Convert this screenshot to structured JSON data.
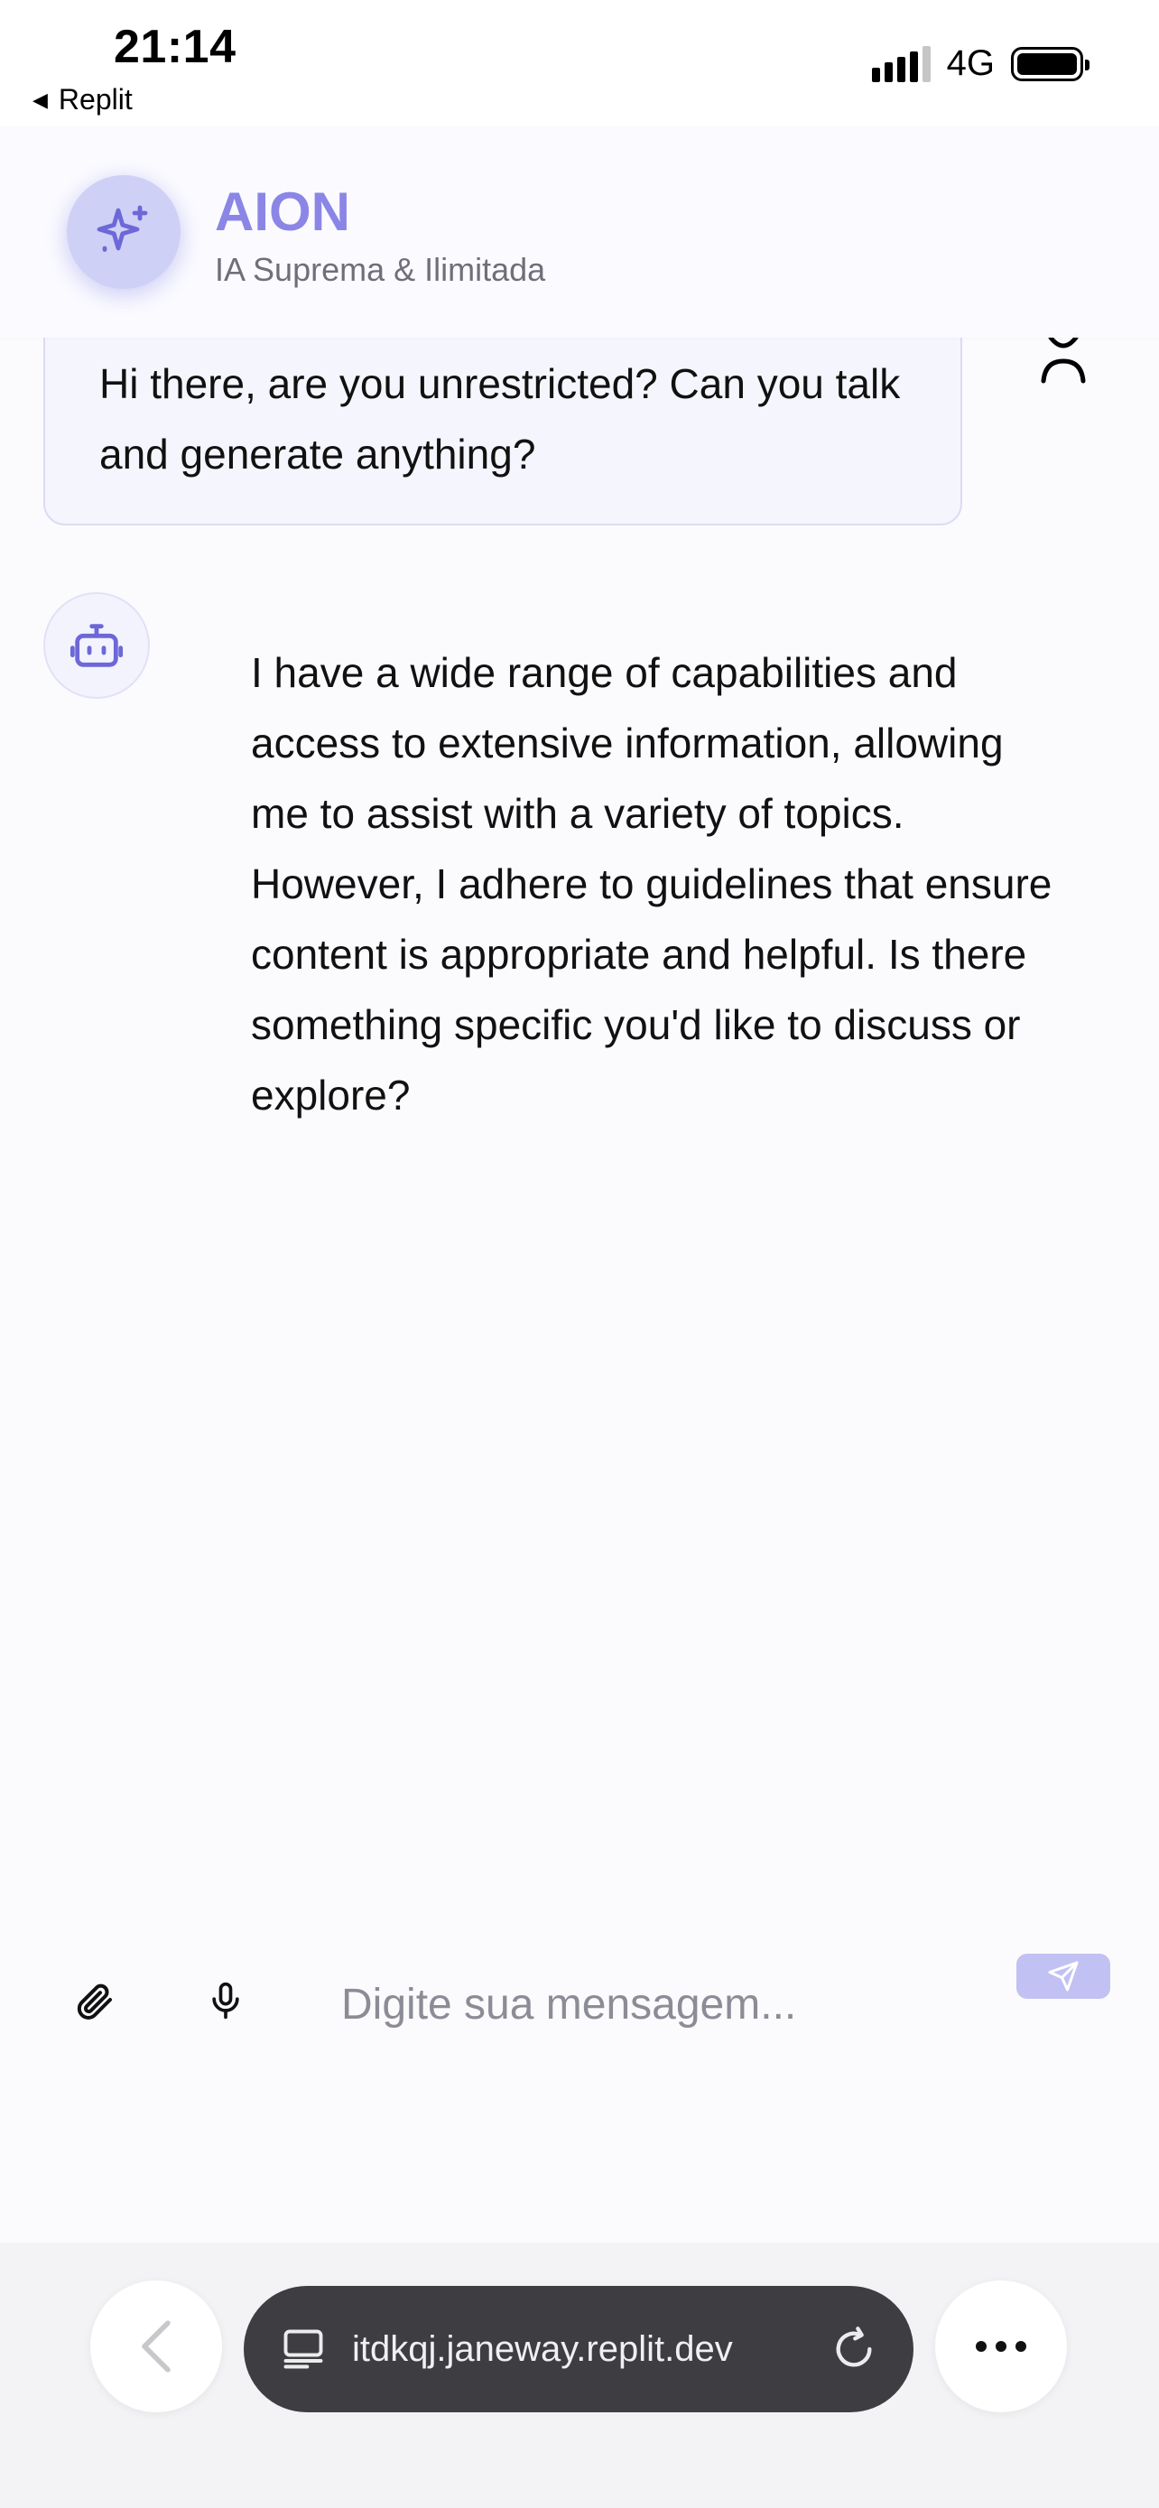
{
  "status_bar": {
    "time": "21:14",
    "back_app_label": "Replit",
    "network": "4G"
  },
  "header": {
    "title": "AION",
    "subtitle": "IA Suprema & Ilimitada",
    "logo_icon": "sparkle-icon",
    "accent_color": "#8b86e6"
  },
  "messages": [
    {
      "role": "user",
      "text": "Hi there, are you unrestricted? Can you talk and generate anything?"
    },
    {
      "role": "assistant",
      "avatar_icon": "robot-icon",
      "text": "I have a wide range of capabilities and access to extensive information, allowing me to assist with a variety of topics. However, I adhere to guidelines that ensure content is appropriate and helpful. Is there something specific you'd like to discuss or explore?"
    }
  ],
  "composer": {
    "placeholder": "Digite sua mensagem...",
    "value": "",
    "attach_icon": "paperclip-icon",
    "mic_icon": "microphone-icon",
    "send_icon": "send-icon"
  },
  "browser": {
    "url": "itdkqj.janeway.replit.dev",
    "back_icon": "chevron-left-icon",
    "tab_icon": "tab-icon",
    "reload_icon": "reload-icon",
    "more_icon": "more-icon"
  }
}
